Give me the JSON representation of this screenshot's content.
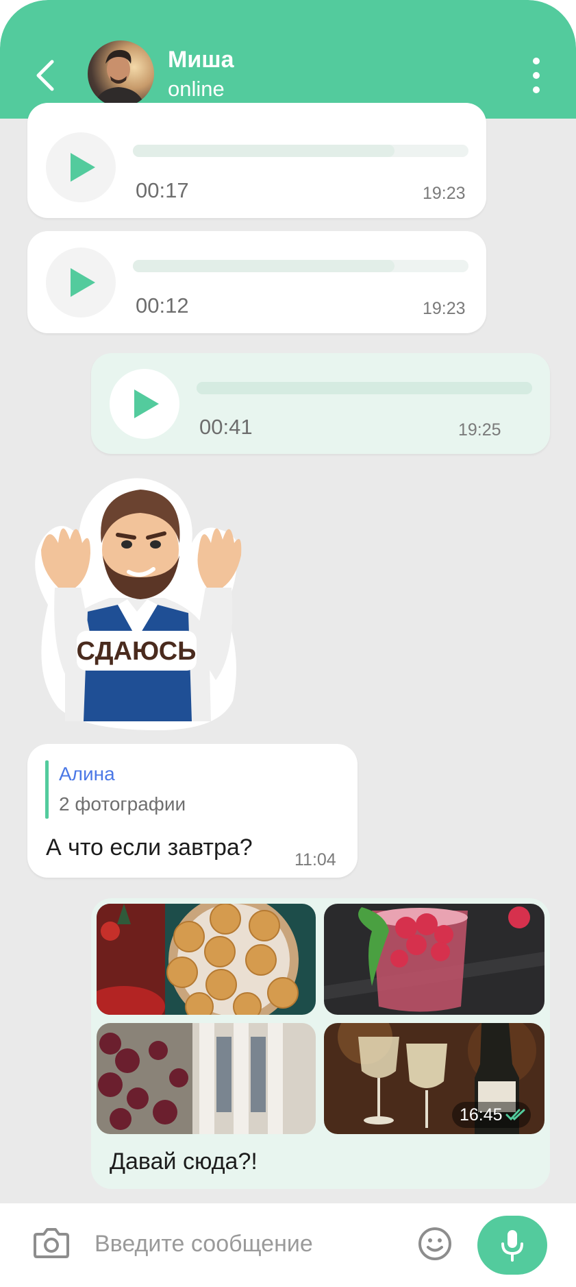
{
  "header": {
    "contact_name": "Миша",
    "contact_status": "online",
    "icons": {
      "back": "chevron-left-icon",
      "menu": "more-vertical-icon"
    },
    "color": "#53cb9d"
  },
  "messages": {
    "voice": [
      {
        "direction": "incoming",
        "duration": "00:17",
        "time": "19:23",
        "progress": 0.78
      },
      {
        "direction": "incoming",
        "duration": "00:12",
        "time": "19:23",
        "progress": 0.78
      },
      {
        "direction": "outgoing",
        "duration": "00:41",
        "time": "19:25",
        "progress": 1.0
      }
    ],
    "sticker": {
      "text": "СДАЮСЬ"
    },
    "reply": {
      "quote_author": "Алина",
      "quote_text": "2 фотографии",
      "text": "А что если завтра?",
      "time": "11:04"
    },
    "photos": {
      "caption": "Давай сюда?!",
      "time": "16:45",
      "status": "read",
      "items": [
        "cookies",
        "raspberry-drink",
        "building-columns",
        "wine-glasses"
      ]
    }
  },
  "input": {
    "placeholder": "Введите сообщение",
    "value": "",
    "icons": {
      "camera": "camera-icon",
      "emoji": "emoji-icon",
      "mic": "microphone-icon"
    }
  },
  "colors": {
    "accent": "#53cb9d",
    "incoming_bubble": "#ffffff",
    "outgoing_bubble": "#e8f5ef",
    "chat_background": "#eaeaea",
    "quote_author": "#4b78e6"
  }
}
